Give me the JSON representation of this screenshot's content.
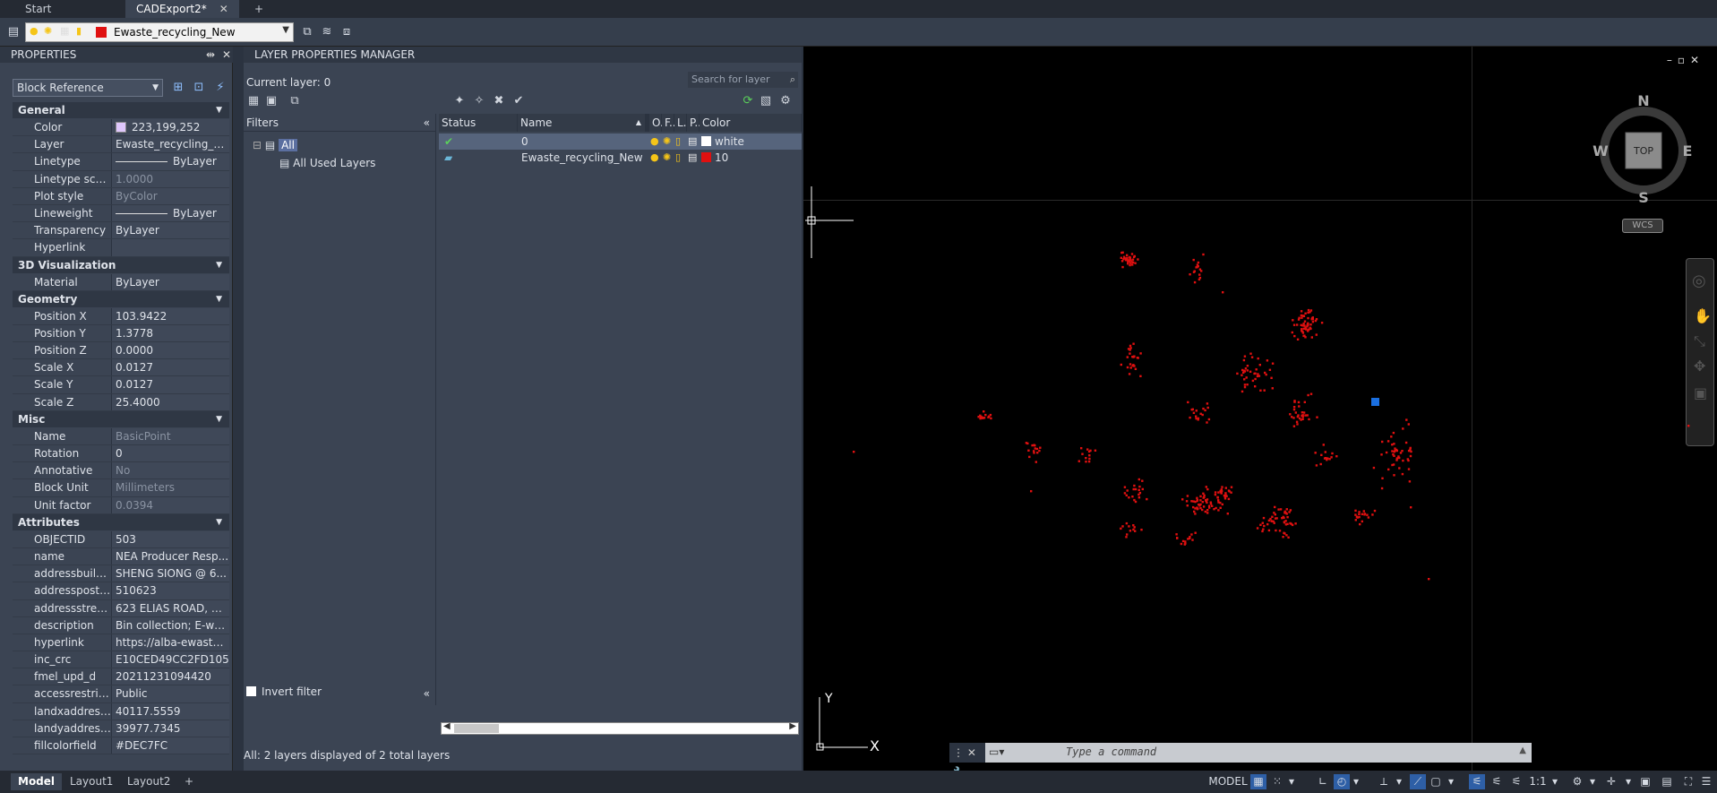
{
  "tabs": [
    {
      "label": "Start"
    },
    {
      "label": "CADExport2*"
    },
    {
      "label": "+"
    }
  ],
  "toolbar": {
    "layer_name": "Ewaste_recycling_New",
    "layer_color": "#e01010"
  },
  "properties": {
    "title": "PROPERTIES",
    "object_type": "Block Reference",
    "sections": {
      "general": "General",
      "vis3d": "3D Visualization",
      "geometry": "Geometry",
      "misc": "Misc",
      "attributes": "Attributes"
    },
    "general": [
      {
        "k": "Color",
        "v": "223,199,252"
      },
      {
        "k": "Layer",
        "v": "Ewaste_recycling_N..."
      },
      {
        "k": "Linetype",
        "v": "ByLayer"
      },
      {
        "k": "Linetype scale",
        "v": "1.0000"
      },
      {
        "k": "Plot style",
        "v": "ByColor"
      },
      {
        "k": "Lineweight",
        "v": "ByLayer"
      },
      {
        "k": "Transparency",
        "v": "ByLayer"
      },
      {
        "k": "Hyperlink",
        "v": ""
      }
    ],
    "vis3d": [
      {
        "k": "Material",
        "v": "ByLayer"
      }
    ],
    "geometry": [
      {
        "k": "Position X",
        "v": "103.9422"
      },
      {
        "k": "Position Y",
        "v": "1.3778"
      },
      {
        "k": "Position Z",
        "v": "0.0000"
      },
      {
        "k": "Scale X",
        "v": "0.0127"
      },
      {
        "k": "Scale Y",
        "v": "0.0127"
      },
      {
        "k": "Scale Z",
        "v": "25.4000"
      }
    ],
    "misc": [
      {
        "k": "Name",
        "v": "BasicPoint"
      },
      {
        "k": "Rotation",
        "v": "0"
      },
      {
        "k": "Annotative",
        "v": "No"
      },
      {
        "k": "Block Unit",
        "v": "Millimeters"
      },
      {
        "k": "Unit factor",
        "v": "0.0394"
      }
    ],
    "attributes": [
      {
        "k": "OBJECTID",
        "v": "503"
      },
      {
        "k": "name",
        "v": "NEA Producer Resp..."
      },
      {
        "k": "addressbuildin...",
        "v": "SHENG SIONG @ 6..."
      },
      {
        "k": "addresspostalc...",
        "v": "510623"
      },
      {
        "k": "addressstreetn...",
        "v": "623 ELIAS ROAD, #B..."
      },
      {
        "k": "description",
        "v": "Bin collection; E-wa..."
      },
      {
        "k": "hyperlink",
        "v": "https://alba-ewaste...."
      },
      {
        "k": "inc_crc",
        "v": "E10CED49CC2FD105"
      },
      {
        "k": "fmel_upd_d",
        "v": "20211231094420"
      },
      {
        "k": "accessrestriction",
        "v": "Public"
      },
      {
        "k": "landxaddressp...",
        "v": "40117.5559"
      },
      {
        "k": "landyaddressp...",
        "v": "39977.7345"
      },
      {
        "k": "fillcolorfield",
        "v": "#DEC7FC"
      }
    ]
  },
  "lpm": {
    "title": "LAYER PROPERTIES MANAGER",
    "current_layer": "Current layer: 0",
    "search_placeholder": "Search for layer",
    "filters_label": "Filters",
    "tree_all": "All",
    "tree_used": "All Used Layers",
    "invert_filter": "Invert filter",
    "columns": {
      "status": "Status",
      "name": "Name",
      "on": "O.",
      "freeze": "F..",
      "lock": "L..",
      "plot": "P..",
      "color": "Color"
    },
    "layers": [
      {
        "name": "0",
        "color_name": "white",
        "color": "#ffffff"
      },
      {
        "name": "Ewaste_recycling_New",
        "color_name": "10",
        "color": "#e01010"
      }
    ],
    "status_text": "All: 2 layers displayed of 2 total layers"
  },
  "viewport": {
    "compass": {
      "n": "N",
      "s": "S",
      "e": "E",
      "w": "W",
      "top": "TOP"
    },
    "wcs": "WCS",
    "ucs_x": "X",
    "ucs_y": "Y",
    "point_color": "#e01010",
    "grip_color": "#1a6fe0"
  },
  "command": {
    "placeholder": "Type a command"
  },
  "layout_tabs": [
    {
      "label": "Model"
    },
    {
      "label": "Layout1"
    },
    {
      "label": "Layout2"
    },
    {
      "label": "+"
    }
  ],
  "status": {
    "model": "MODEL",
    "scale": "1:1"
  }
}
